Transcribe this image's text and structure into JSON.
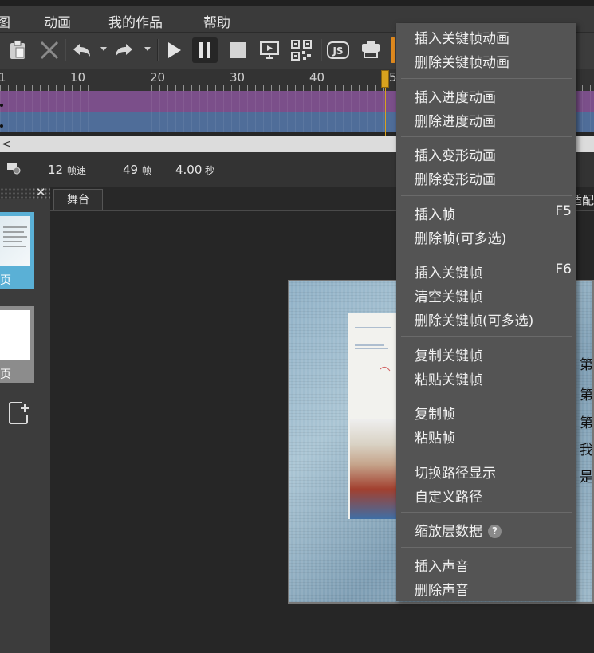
{
  "menubar": {
    "items": [
      "图",
      "动画",
      "我的作品",
      "帮助"
    ]
  },
  "toolbar": {
    "icons": [
      "paste-icon",
      "delete-icon",
      "undo-icon",
      "redo-icon",
      "play-icon",
      "pause-icon",
      "stop-icon",
      "preview-icon",
      "qrcode-icon",
      "js-icon",
      "publish-icon"
    ]
  },
  "timeline": {
    "ruler_labels": [
      "1",
      "10",
      "20",
      "30",
      "40",
      "5"
    ],
    "playhead_color": "#d8a21e",
    "track_colors": [
      "#7b4f8a",
      "#4f6d99"
    ],
    "scroll_left_glyph": "<"
  },
  "status": {
    "fps_value": "12",
    "fps_unit": "帧速",
    "frames_value": "49",
    "frames_unit": "帧",
    "seconds_value": "4.00",
    "seconds_unit": "秒"
  },
  "pages": {
    "close_glyph": "✕",
    "page1_label": "页",
    "page2_label": "页"
  },
  "stage": {
    "tab_label": "舞台",
    "fit_label": "适配"
  },
  "canvas": {
    "side_chars": [
      "第",
      "第",
      "第",
      "我",
      "是"
    ]
  },
  "context_menu": {
    "insert_keyframe_anim": "插入关键帧动画",
    "delete_keyframe_anim": "删除关键帧动画",
    "insert_progress_anim": "插入进度动画",
    "delete_progress_anim": "删除进度动画",
    "insert_transform_anim": "插入变形动画",
    "delete_transform_anim": "删除变形动画",
    "insert_frame": "插入帧",
    "insert_frame_shortcut": "F5",
    "delete_frame": "删除帧(可多选)",
    "insert_keyframe": "插入关键帧",
    "insert_keyframe_shortcut": "F6",
    "clear_keyframe": "清空关键帧",
    "delete_keyframe": "删除关键帧(可多选)",
    "copy_keyframe": "复制关键帧",
    "paste_keyframe": "粘贴关键帧",
    "copy_frame": "复制帧",
    "paste_frame": "粘贴帧",
    "toggle_path": "切换路径显示",
    "custom_path": "自定义路径",
    "scale_layer_data": "缩放层数据",
    "help_glyph": "?",
    "insert_sound": "插入声音",
    "delete_sound": "删除声音"
  }
}
